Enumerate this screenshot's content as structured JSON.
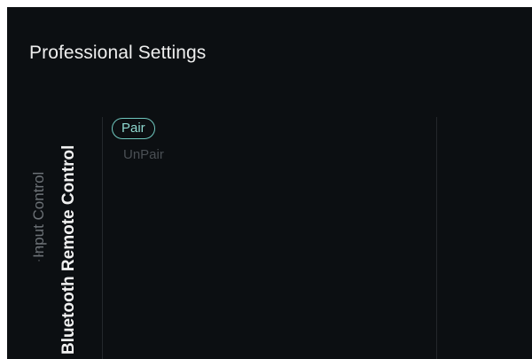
{
  "header": {
    "title": "Professional Settings"
  },
  "breadcrumb": {
    "previous": "Input Control",
    "ellipsis": "•••",
    "current": "Bluetooth Remote Control"
  },
  "menu": {
    "items": [
      {
        "label": "Pair",
        "state": "focused"
      },
      {
        "label": "UnPair",
        "state": "disabled"
      }
    ]
  },
  "colors": {
    "background": "#0c0f12",
    "accent": "#6fc7be",
    "text_primary": "#f1f1f1",
    "text_dim": "#6d7277",
    "text_disabled": "#4a4f54"
  }
}
